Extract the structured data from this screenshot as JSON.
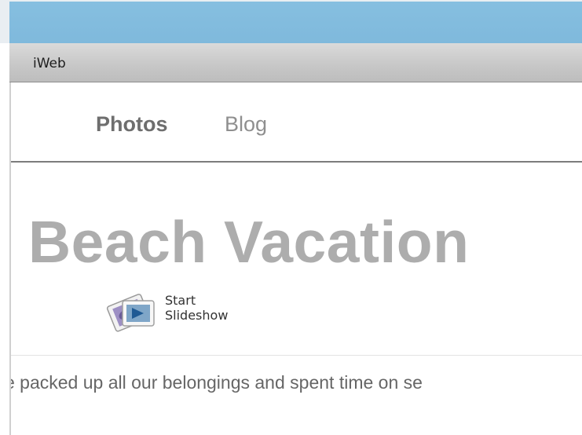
{
  "app": {
    "menubar_title": "iWeb"
  },
  "nav": {
    "items": [
      {
        "label": "Photos"
      },
      {
        "label": "Blog"
      }
    ]
  },
  "page": {
    "title": "Beach Vacation",
    "slideshow_button": {
      "line1": "Start",
      "line2": "Slideshow",
      "icon": "slideshow-icon"
    },
    "description": "e packed up all our belongings and spent time on se"
  },
  "colors": {
    "sky": "#86bfe0",
    "title": "#adadad",
    "nav_active": "#6e6e6e",
    "nav_inactive": "#8f8f8f"
  }
}
